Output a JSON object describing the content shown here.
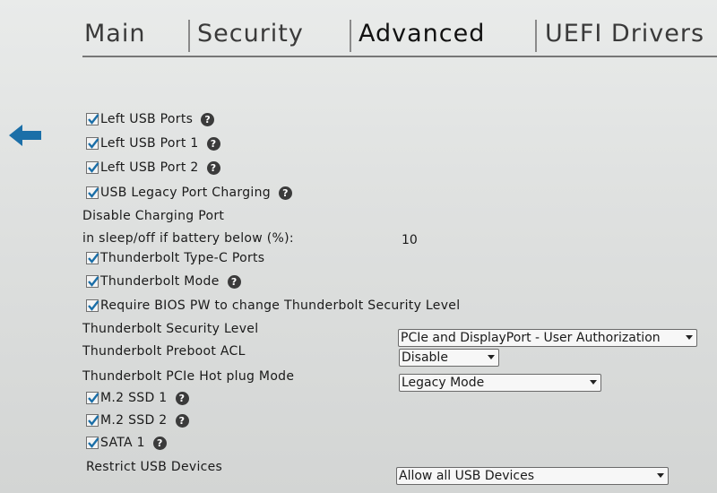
{
  "tabs": [
    {
      "label": "Main"
    },
    {
      "label": "Security"
    },
    {
      "label": "Advanced"
    },
    {
      "label": "UEFI Drivers"
    }
  ],
  "active_tab": "Advanced",
  "back_icon": "back-arrow-icon",
  "accent_color": "#1b6fa8",
  "items": {
    "left_usb_ports": {
      "label": "Left USB Ports",
      "checked": true
    },
    "left_usb_port_1": {
      "label": "Left USB Port 1",
      "checked": true
    },
    "left_usb_port_2": {
      "label": "Left USB Port 2",
      "checked": true
    },
    "usb_legacy_charging": {
      "label": "USB Legacy Port Charging",
      "checked": true
    },
    "disable_charging_line1": "Disable Charging Port",
    "disable_charging_line2": "in sleep/off if battery below (%):",
    "disable_charging_value": "10",
    "thunderbolt_typec": {
      "label": "Thunderbolt Type-C Ports",
      "checked": true
    },
    "thunderbolt_mode": {
      "label": "Thunderbolt Mode",
      "checked": true
    },
    "require_bios_pw": {
      "label": "Require BIOS PW to change Thunderbolt Security Level",
      "checked": true
    },
    "tb_security_level": {
      "label": "Thunderbolt Security Level",
      "value": "PCIe and DisplayPort - User Authorization"
    },
    "tb_preboot_acl": {
      "label": "Thunderbolt Preboot ACL",
      "value": "Disable"
    },
    "tb_hotplug_mode": {
      "label": "Thunderbolt PCIe Hot plug Mode",
      "value": "Legacy Mode"
    },
    "m2_ssd_1": {
      "label": "M.2 SSD 1",
      "checked": true
    },
    "m2_ssd_2": {
      "label": "M.2 SSD 2",
      "checked": true
    },
    "sata_1": {
      "label": "SATA 1",
      "checked": true
    },
    "restrict_usb": {
      "label": "Restrict USB Devices",
      "value": "Allow all USB Devices"
    }
  },
  "help_symbol": "?"
}
